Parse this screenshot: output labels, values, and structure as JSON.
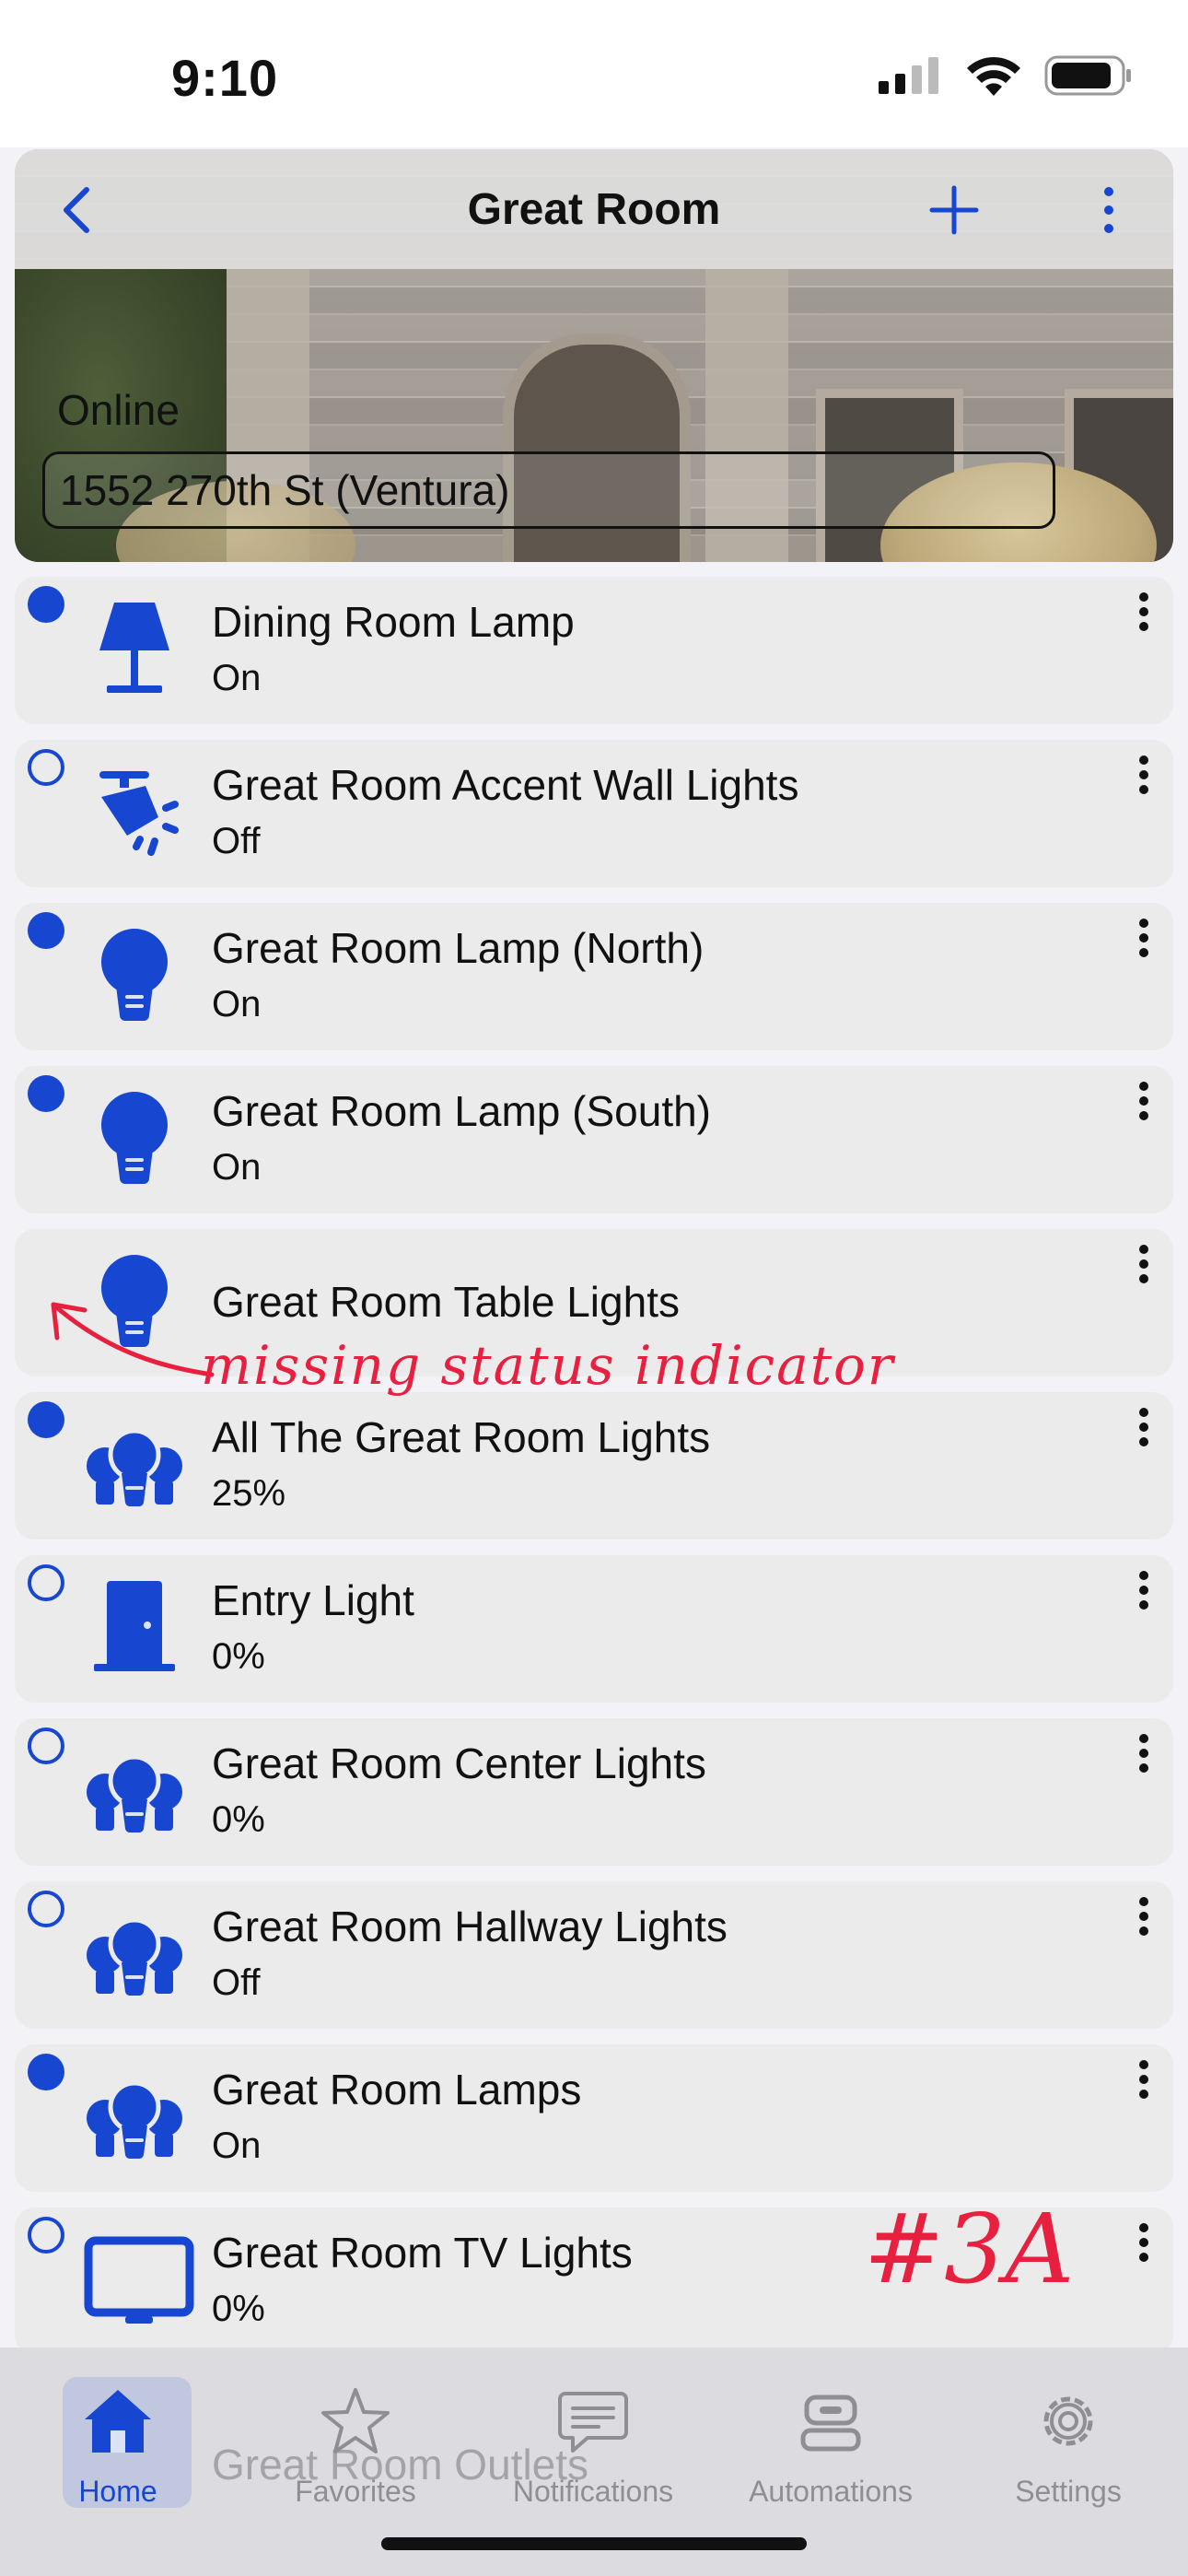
{
  "status_bar": {
    "time": "9:10"
  },
  "header": {
    "title": "Great Room",
    "connection_status": "Online",
    "home_selector": "1552 270th St (Ventura)"
  },
  "devices": [
    {
      "name": "Dining Room Lamp",
      "status": "On",
      "indicator": "on",
      "icon": "table-lamp-icon"
    },
    {
      "name": "Great Room Accent Wall Lights",
      "status": "Off",
      "indicator": "off",
      "icon": "spotlight-icon"
    },
    {
      "name": "Great Room Lamp (North)",
      "status": "On",
      "indicator": "on",
      "icon": "lightbulb-icon"
    },
    {
      "name": "Great Room Lamp (South)",
      "status": "On",
      "indicator": "on",
      "icon": "lightbulb-icon"
    },
    {
      "name": "Great Room Table Lights",
      "status": "",
      "indicator": "none",
      "icon": "lightbulb-icon"
    },
    {
      "name": "All The Great Room Lights",
      "status": "25%",
      "indicator": "on",
      "icon": "light-group-icon"
    },
    {
      "name": "Entry Light",
      "status": "0%",
      "indicator": "off",
      "icon": "door-icon"
    },
    {
      "name": "Great Room Center Lights",
      "status": "0%",
      "indicator": "off",
      "icon": "light-group-icon"
    },
    {
      "name": "Great Room Hallway Lights",
      "status": "Off",
      "indicator": "off",
      "icon": "light-group-icon"
    },
    {
      "name": "Great Room Lamps",
      "status": "On",
      "indicator": "on",
      "icon": "light-group-icon"
    },
    {
      "name": "Great Room TV Lights",
      "status": "0%",
      "indicator": "off",
      "icon": "tv-icon"
    }
  ],
  "partially_hidden_row": "Great Room Outlets",
  "annotations": {
    "note": "missing status indicator",
    "tag": "#3A"
  },
  "tabs": [
    {
      "label": "Home",
      "icon": "house-icon",
      "active": true
    },
    {
      "label": "Favorites",
      "icon": "star-icon",
      "active": false
    },
    {
      "label": "Notifications",
      "icon": "message-icon",
      "active": false
    },
    {
      "label": "Automations",
      "icon": "robot-icon",
      "active": false
    },
    {
      "label": "Settings",
      "icon": "gear-icon",
      "active": false
    }
  ],
  "colors": {
    "accent": "#1746d1",
    "annotation": "#e8203f",
    "row_bg": "#ebebeb"
  }
}
